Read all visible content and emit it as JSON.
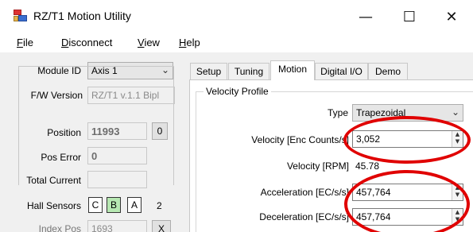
{
  "window": {
    "title": "RZ/T1 Motion Utility",
    "minimize_glyph": "—",
    "maximize_glyph": "☐",
    "close_glyph": "✕"
  },
  "menu": {
    "items": [
      {
        "accel": "F",
        "rest": "ile"
      },
      {
        "accel": "D",
        "rest": "isconnect"
      },
      {
        "accel": "V",
        "rest": "iew"
      },
      {
        "accel": "H",
        "rest": "elp"
      }
    ]
  },
  "left": {
    "module_id_label": "Module ID",
    "module_id_value": "Axis 1",
    "fw_label": "F/W Version",
    "fw_value": "RZ/T1 v.1.1 Bipl",
    "position_label": "Position",
    "position_value": "11993",
    "position_reset": "0",
    "pos_error_label": "Pos Error",
    "pos_error_value": "0",
    "total_current_label": "Total Current",
    "total_current_value": "",
    "hall_label": "Hall Sensors",
    "hall": [
      "C",
      "B",
      "A"
    ],
    "hall_count": "2",
    "index_pos_label": "Index Pos",
    "index_pos_value": "1693",
    "index_pos_button": "X"
  },
  "tabs": [
    "Setup",
    "Tuning",
    "Motion",
    "Digital I/O",
    "Demo"
  ],
  "active_tab": "Motion",
  "motion": {
    "group_title": "Velocity Profile",
    "type_label": "Type",
    "type_value": "Trapezoidal",
    "velocity_label": "Velocity [Enc Counts/s]",
    "velocity_value": "3,052",
    "velocity_rpm_label": "Velocity [RPM]",
    "velocity_rpm_value": "45.78",
    "accel_label": "Acceleration [EC/s/s]",
    "accel_value": "457,764",
    "decel_label": "Deceleration [EC/s/s]",
    "decel_value": "457,764"
  },
  "colors": {
    "annotation_ring": "#e00000",
    "hall_active": "#b7e8b2"
  }
}
